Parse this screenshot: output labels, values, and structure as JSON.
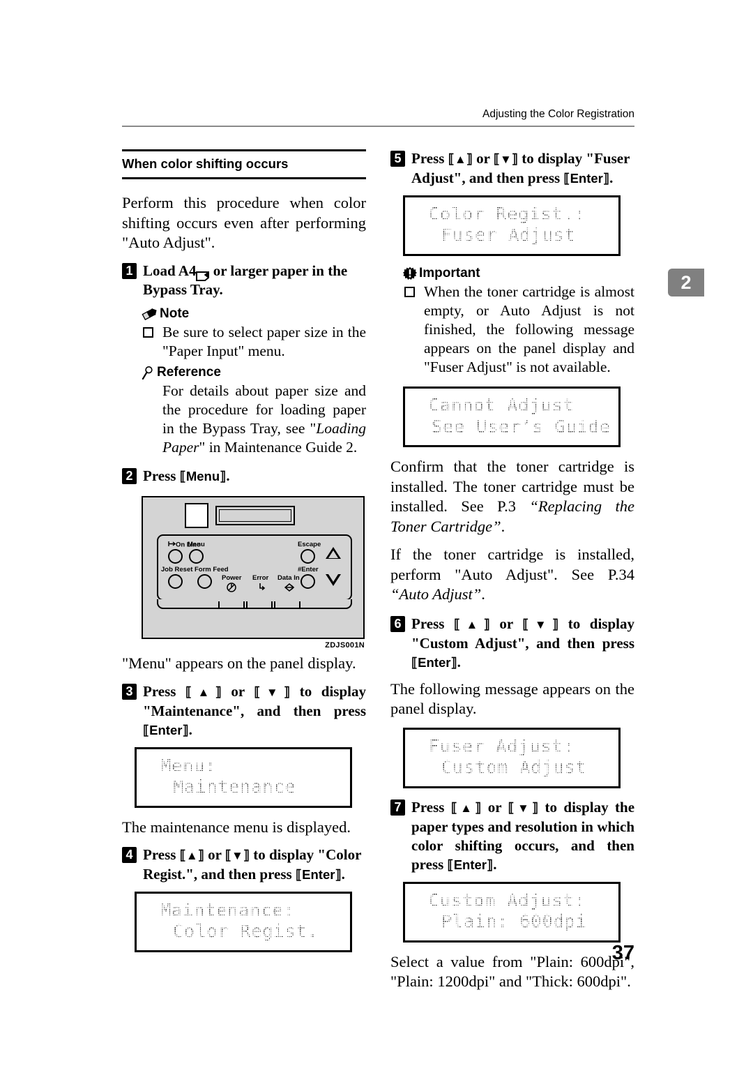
{
  "document": {
    "running_header": "Adjusting the Color Registration",
    "chapter_tab": "2",
    "page_number": "37",
    "figure_caption": "ZDJS001N"
  },
  "left_column": {
    "section_heading": "When color shifting occurs",
    "intro_paragraph": "Perform this procedure when color shifting occurs even after performing \"Auto Adjust\".",
    "step1": {
      "number": "1",
      "text_before": "Load A4",
      "paper_icon": "landscape-paper-icon",
      "text_after": " or larger paper in the Bypass Tray."
    },
    "note": {
      "icon": "pencil-icon",
      "title": "Note",
      "bullet_text": "Be sure to select paper size in the \"Paper Input\" menu."
    },
    "reference": {
      "icon": "magnifier-icon",
      "title": "Reference",
      "text_part1": "For details about paper size and the procedure for loading paper in the Bypass Tray, see \"",
      "text_italic": "Loading Paper",
      "text_part2": "\" in Maintenance Guide 2."
    },
    "step2": {
      "number": "2",
      "text_before": "Press ",
      "key": "Menu",
      "text_after": "."
    },
    "step2_result": "\"Menu\" appears on the panel display.",
    "step3": {
      "number": "3",
      "text_before": "Press ",
      "key_up": "▲",
      "text_or": " or ",
      "key_down": "▼",
      "text_mid": " to display \"Maintenance\", and then press ",
      "key_enter": "Enter",
      "text_after": "."
    },
    "lcd_menu": {
      "line1": "Menu:",
      "line2": "Maintenance"
    },
    "step3_result": "The maintenance menu is displayed.",
    "step4": {
      "number": "4",
      "text_before": "Press ",
      "key_up": "▲",
      "text_or": " or ",
      "key_down": "▼",
      "text_mid": " to display \"Color Regist.\", and then press ",
      "key_enter": "Enter",
      "text_after": "."
    },
    "lcd_maintenance": {
      "line1": "Maintenance:",
      "line2": "Color Regist."
    },
    "panel_figure": {
      "on_line_label": "On Line",
      "menu_label": "Menu",
      "job_reset_label": "Job Reset",
      "form_feed_label": "Form Feed",
      "escape_label": "Escape",
      "enter_label": "Enter",
      "power_label": "Power",
      "error_label": "Error",
      "data_in_label": "Data In",
      "up_arrow_icon": "triangle-up-icon",
      "down_arrow_icon": "triangle-down-icon",
      "power_icon": "power-symbol-icon",
      "error_icon": "error-bolt-icon",
      "data_in_icon": "data-diamond-icon"
    }
  },
  "right_column": {
    "step5": {
      "number": "5",
      "text_before": "Press ",
      "key_up": "▲",
      "text_or": " or ",
      "key_down": "▼",
      "text_mid": " to display \"Fuser Adjust\", and then press ",
      "key_enter": "Enter",
      "text_after": "."
    },
    "lcd_color_regist": {
      "line1": "Color Regist.:",
      "line2": "Fuser Adjust"
    },
    "important": {
      "icon": "important-burst-icon",
      "title": "Important",
      "bullet_text": "When the toner cartridge is almost empty, or Auto Adjust is not finished, the following message appears on the panel display and \"Fuser Adjust\" is not available."
    },
    "lcd_cannot_adjust": {
      "line1": "Cannot Adjust",
      "line2": "See User’s Guide"
    },
    "para_confirm_part1": "Confirm that the toner cartridge is installed. The toner cartridge must be installed. See P.3 ",
    "para_confirm_italic": "“Replacing the Toner Cartridge”",
    "para_confirm_part2": ".",
    "para_if_part1": "If the toner cartridge is installed, perform \"Auto Adjust\". See P.34 ",
    "para_if_italic": "“Auto Adjust”",
    "para_if_part2": ".",
    "step6": {
      "number": "6",
      "text_before": "Press ",
      "key_up": "▲",
      "text_or": " or ",
      "key_down": "▼",
      "text_mid": " to display \"Custom Adjust\", and then press ",
      "key_enter": "Enter",
      "text_after": "."
    },
    "step6_result": "The following message appears on the panel display.",
    "lcd_fuser_adjust": {
      "line1": "Fuser Adjust:",
      "line2": "Custom Adjust"
    },
    "step7": {
      "number": "7",
      "text_before": "Press ",
      "key_up": "▲",
      "text_or": " or ",
      "key_down": "▼",
      "text_mid": " to display the paper types and resolution in which color shifting occurs, and then press ",
      "key_enter": "Enter",
      "text_after": "."
    },
    "lcd_custom_adjust": {
      "line1": "Custom Adjust:",
      "line2": "Plain: 600dpi"
    },
    "step7_result": "Select a value from \"Plain: 600dpi\", \"Plain: 1200dpi\" and \"Thick: 600dpi\"."
  }
}
